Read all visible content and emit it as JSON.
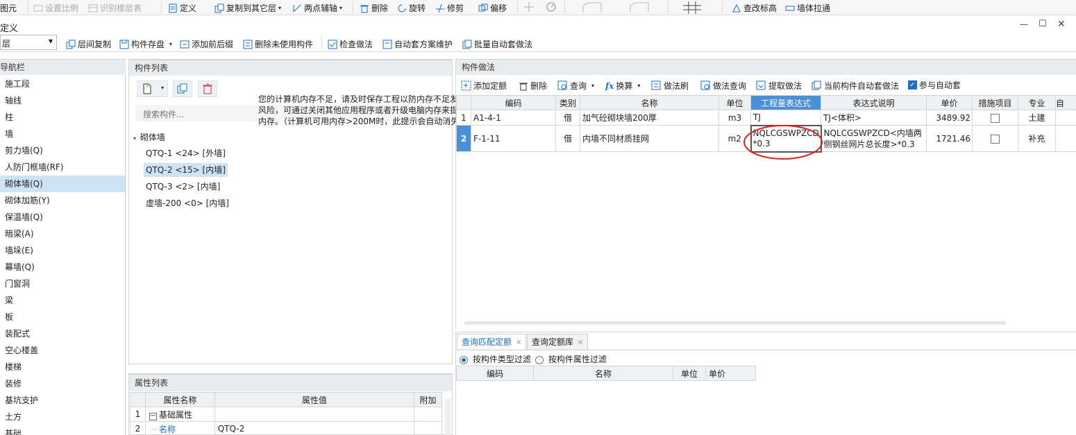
{
  "top_toolbar": {
    "items": [
      "图元",
      "设置比例",
      "识别楼层表",
      "定义",
      "复制到其它层",
      "两点辅轴",
      "删除",
      "旋转",
      "修剪",
      "偏移",
      "查改标高",
      "墙体拉通"
    ]
  },
  "window": {
    "title": "定义",
    "minimize": "—",
    "maximize": "☐",
    "close": "✕"
  },
  "sub_toolbar": {
    "floor_select": "层",
    "items": [
      "层间复制",
      "构件存盘",
      "添加前后缀",
      "删除未使用构件",
      "检查做法",
      "自动套方案维护",
      "批量自动套做法"
    ]
  },
  "nav": {
    "header": "导航栏",
    "items": [
      "施工段",
      "轴线",
      "柱",
      "墙",
      "剪力墙(Q)",
      "人防门框墙(RF)",
      "砌体墙(Q)",
      "砌体加筋(Y)",
      "保温墙(Q)",
      "暗梁(A)",
      "墙垛(E)",
      "幕墙(Q)",
      "门窗洞",
      "梁",
      "板",
      "装配式",
      "空心楼盖",
      "楼梯",
      "装修",
      "基坑支护",
      "土方",
      "基础"
    ]
  },
  "component_list": {
    "header": "构件列表",
    "search_placeholder": "搜索构件...",
    "group": "砌体墙",
    "items": [
      "QTQ-1 <24> [外墙]",
      "QTQ-2 <15> [内墙]",
      "QTQ-3 <2> [内墙]",
      "虚墙-200 <0> [内墙]"
    ]
  },
  "warning": {
    "text": "您的计算机内存不足，请及时保存工程以防内存不足发生内存溢出等风险，可通过关闭其他应用程序或者升级电脑内存来提升计算机可用内存。（计算机可用内存>200M时，此提示会自动消失）"
  },
  "properties": {
    "header": "属性列表",
    "columns": [
      "属性名称",
      "属性值",
      "附加"
    ],
    "rows": [
      {
        "num": "1",
        "name": "基础属性",
        "value": "",
        "expander": "−"
      },
      {
        "num": "2",
        "name": "名称",
        "value": "QTQ-2"
      }
    ]
  },
  "method": {
    "header": "构件做法",
    "toolbar": [
      "添加定额",
      "删除",
      "查询",
      "换算",
      "做法刷",
      "做法查询",
      "提取做法",
      "当前构件自动套做法",
      "参与自动套"
    ],
    "columns": [
      "编码",
      "类别",
      "名称",
      "单位",
      "工程量表达式",
      "表达式说明",
      "单价",
      "措施项目",
      "专业",
      "自"
    ],
    "rows": [
      {
        "num": "1",
        "code": "A1-4-1",
        "type": "借",
        "name": "加气砼砌块墙200厚",
        "unit": "m3",
        "expr": "TJ",
        "desc": "TJ<体积>",
        "price": "3489.92",
        "major": "土建"
      },
      {
        "num": "2",
        "code": "F-1-11",
        "type": "借",
        "name": "内墙不同材质挂网",
        "unit": "m2",
        "expr": "NQLCGSWPZCD*0.3",
        "desc": "NQLCGSWPZCD<内墙两侧钢丝网片总长度>*0.3",
        "price": "1721.46",
        "major": "补充"
      }
    ]
  },
  "query": {
    "tabs": [
      "查询匹配定额",
      "查询定额库"
    ],
    "filters": [
      "按构件类型过滤",
      "按构件属性过滤"
    ],
    "columns": [
      "编码",
      "名称",
      "单位",
      "单价"
    ]
  },
  "colors": {
    "accent": "#1d6fc2",
    "selected": "#cfe3f7",
    "highlight_header": "#4a90d9",
    "annotation": "#e02020"
  }
}
